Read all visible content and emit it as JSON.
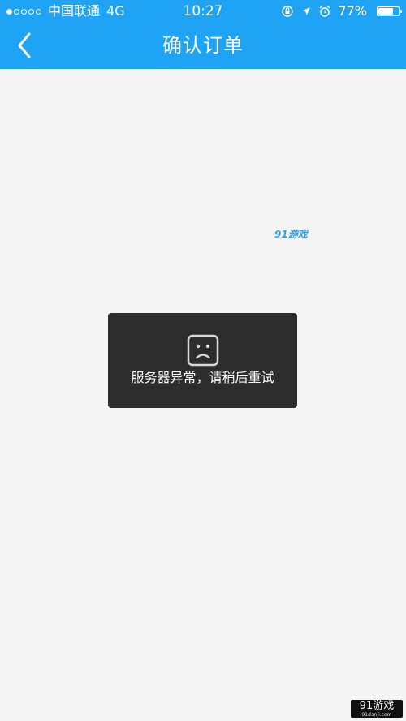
{
  "status_bar": {
    "carrier": "中国联通",
    "network": "4G",
    "time": "10:27",
    "battery_percent": "77%",
    "battery_level": 0.77,
    "icons": [
      "signal-dots-icon",
      "rotation-lock-icon",
      "location-arrow-icon",
      "alarm-clock-icon",
      "battery-icon"
    ]
  },
  "header": {
    "title": "确认订单",
    "back_icon": "chevron-left-icon"
  },
  "watermark": {
    "text": "91游戏"
  },
  "toast": {
    "icon": "sad-face-icon",
    "message": "服务器异常，请稍后重试"
  },
  "corner_logo": {
    "text": "91游戏",
    "url": "91danji.com"
  },
  "colors": {
    "header_bg": "#1ea3f5",
    "page_bg": "#f4f4f4",
    "toast_bg": "#2d2d2d"
  }
}
